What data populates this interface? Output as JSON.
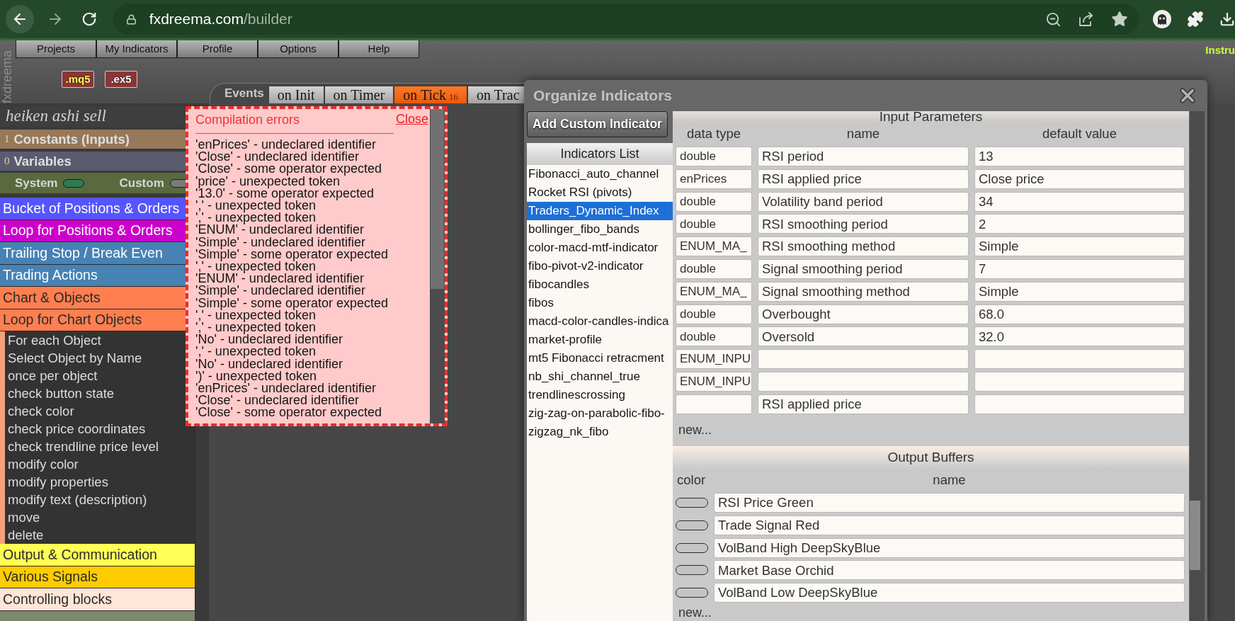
{
  "browser": {
    "url_host": "fxdreema.com",
    "url_path": "/builder"
  },
  "logo": "fxdreema",
  "menu": [
    "Projects",
    "My Indicators",
    "Profile",
    "Options",
    "Help"
  ],
  "corner_link": "Instru",
  "file_badges": [
    {
      "label": ".mq5",
      "kind": "source"
    },
    {
      "label": ".ex5",
      "kind": "compiled"
    }
  ],
  "events": {
    "label": "Events",
    "tabs": [
      {
        "label": "on Init",
        "selected": false
      },
      {
        "label": "on Timer",
        "selected": false
      },
      {
        "label": "on Tick",
        "count": "16",
        "selected": true
      },
      {
        "label": "on Trac",
        "selected": false
      }
    ]
  },
  "sidebar": {
    "project": "heiken ashi sell",
    "sections": [
      {
        "kind": "constants",
        "count": "1",
        "label": "Constants (Inputs)"
      },
      {
        "kind": "variables",
        "count": "0",
        "label": "Variables"
      }
    ],
    "toggles": [
      {
        "label": "System",
        "on": true
      },
      {
        "label": "Custom",
        "on": false
      }
    ],
    "categories": [
      {
        "label": "Bucket of Positions & Orders",
        "color": "#5555ff"
      },
      {
        "label": "Loop for Positions & Orders",
        "color": "#cc00cc"
      },
      {
        "label": "Trailing Stop / Break Even",
        "color": "#4682b4"
      },
      {
        "label": "Trading Actions",
        "color": "#4682b4"
      },
      {
        "label": "Chart & Objects",
        "color": "#ff7f50"
      },
      {
        "label": "Loop for Chart Objects",
        "color": "#ff7f50",
        "children": [
          "For each Object",
          "Select Object by Name",
          "once per object",
          "check button state",
          "check color",
          "check price coordinates",
          "check trendline price level",
          "modify color",
          "modify properties",
          "modify text (description)",
          "move",
          "delete"
        ]
      },
      {
        "label": "Output & Communication",
        "color": "#ffff55"
      },
      {
        "label": "Various Signals",
        "color": "#ffcc00"
      },
      {
        "label": "Controlling blocks",
        "color": "#ffe6d6"
      },
      {
        "color": "#7b8a6b"
      }
    ]
  },
  "compile_errors": {
    "title": "Compilation errors",
    "close": "Close",
    "lines": [
      "'enPrices' - undeclared identifier",
      "'Close' - undeclared identifier",
      "'Close' - some operator expected",
      "'price' - unexpected token",
      "'13.0' - some operator expected",
      "',' - unexpected token",
      "',' - unexpected token",
      "'ENUM' - undeclared identifier",
      "'Simple' - undeclared identifier",
      "'Simple' - some operator expected",
      "',' - unexpected token",
      "'ENUM' - undeclared identifier",
      "'Simple' - undeclared identifier",
      "'Simple' - some operator expected",
      "',' - unexpected token",
      "',' - unexpected token",
      "'No' - undeclared identifier",
      "',' - unexpected token",
      "'No' - undeclared identifier",
      "')' - unexpected token",
      "'enPrices' - undeclared identifier",
      "'Close' - undeclared identifier",
      "'Close' - some operator expected"
    ]
  },
  "dialog": {
    "title": "Organize Indicators",
    "add_button": "Add Custom Indicator",
    "list_title": "Indicators List",
    "indicators": [
      {
        "label": "Fibonacci_auto_channel",
        "selected": false
      },
      {
        "label": "Rocket RSI (pivots)",
        "selected": false
      },
      {
        "label": "Traders_Dynamic_Index",
        "selected": true
      },
      {
        "label": "bollinger_fibo_bands",
        "selected": false
      },
      {
        "label": "color-macd-mtf-indicator",
        "selected": false
      },
      {
        "label": "fibo-pivot-v2-indicator",
        "selected": false
      },
      {
        "label": "fibocandles",
        "selected": false
      },
      {
        "label": "fibos",
        "selected": false
      },
      {
        "label": "macd-color-candles-indica",
        "selected": false
      },
      {
        "label": "market-profile",
        "selected": false
      },
      {
        "label": "mt5 Fibonacci retracment",
        "selected": false
      },
      {
        "label": "nb_shi_channel_true",
        "selected": false
      },
      {
        "label": "trendlinescrossing",
        "selected": false
      },
      {
        "label": "zig-zag-on-parabolic-fibo-",
        "selected": false
      },
      {
        "label": "zigzag_nk_fibo",
        "selected": false
      }
    ],
    "inputs": {
      "title": "Input Parameters",
      "columns": [
        "data type",
        "name",
        "default value"
      ],
      "rows": [
        {
          "type": "double",
          "name": "RSI period",
          "value": "13"
        },
        {
          "type": "enPrices",
          "name": "RSI applied price",
          "value": "Close price"
        },
        {
          "type": "double",
          "name": "Volatility band period",
          "value": "34"
        },
        {
          "type": "double",
          "name": "RSI smoothing period",
          "value": "2"
        },
        {
          "type": "ENUM_MA_",
          "name": "RSI smoothing method",
          "value": "Simple"
        },
        {
          "type": "double",
          "name": "Signal smoothing period",
          "value": "7"
        },
        {
          "type": "ENUM_MA_",
          "name": "Signal smoothing method",
          "value": "Simple"
        },
        {
          "type": "double",
          "name": "Overbought",
          "value": "68.0"
        },
        {
          "type": "double",
          "name": "Oversold",
          "value": "32.0"
        },
        {
          "type": "ENUM_INPU"
        },
        {
          "type": "ENUM_INPU"
        },
        {
          "name": "RSI applied price"
        }
      ],
      "new_link": "new..."
    },
    "outputs": {
      "title": "Output Buffers",
      "columns": [
        "color",
        "name"
      ],
      "rows": [
        {
          "name": "RSI Price Green"
        },
        {
          "name": "Trade Signal Red"
        },
        {
          "name": "VolBand High DeepSkyBlue"
        },
        {
          "name": "Market Base Orchid"
        },
        {
          "name": "VolBand Low DeepSkyBlue"
        }
      ],
      "new_link": "new..."
    }
  }
}
